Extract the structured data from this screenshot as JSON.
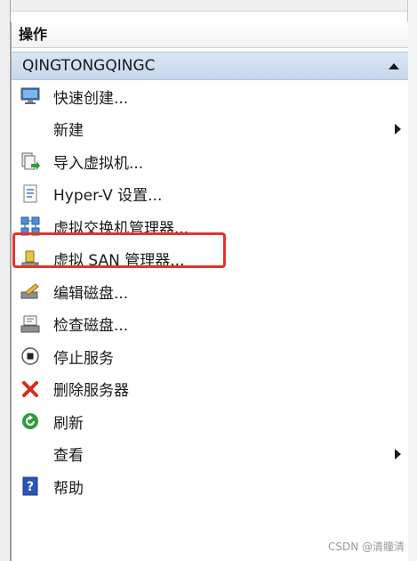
{
  "panel": {
    "title": "操作",
    "group": {
      "label": "QINGTONGQINGC"
    },
    "items": [
      {
        "label": "快速创建..."
      },
      {
        "label": "新建"
      },
      {
        "label": "导入虚拟机..."
      },
      {
        "label": "Hyper-V 设置..."
      },
      {
        "label": "虚拟交换机管理器..."
      },
      {
        "label": "虚拟 SAN 管理器..."
      },
      {
        "label": "编辑磁盘..."
      },
      {
        "label": "检查磁盘..."
      },
      {
        "label": "停止服务"
      },
      {
        "label": "删除服务器"
      },
      {
        "label": "刷新"
      },
      {
        "label": "查看"
      },
      {
        "label": "帮助"
      }
    ]
  },
  "icons": {
    "quick_create": "monitor-icon",
    "import": "import-vm-icon",
    "settings": "settings-document-icon",
    "switch_manager": "network-switch-icon",
    "san_manager": "san-storage-icon",
    "edit_disk": "edit-disk-icon",
    "inspect_disk": "inspect-disk-icon",
    "stop_service": "stop-circle-icon",
    "remove_server": "red-x-icon",
    "refresh": "green-refresh-icon",
    "help": "help-book-icon"
  },
  "colors": {
    "group_header_bg": "#c7d7ec",
    "highlight_border": "#e8312b",
    "delete_red": "#d62c1f",
    "refresh_green": "#2e9b3a",
    "help_blue": "#2b55b8"
  },
  "watermark": "CSDN @清瞳清"
}
